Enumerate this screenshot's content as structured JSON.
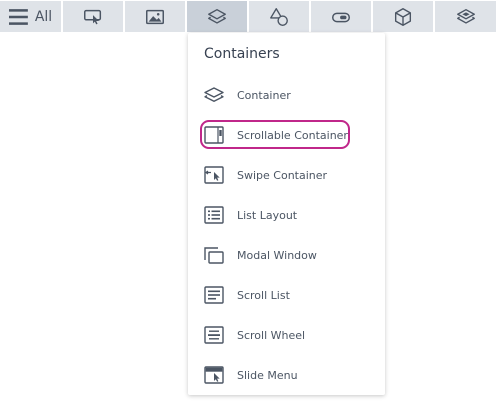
{
  "toolbar": {
    "all_label": "All",
    "tabs": [
      {
        "icon": "tap-gesture-icon"
      },
      {
        "icon": "image-icon"
      },
      {
        "icon": "layers-icon",
        "active": true
      },
      {
        "icon": "shapes-icon"
      },
      {
        "icon": "toggle-icon"
      },
      {
        "icon": "cube-icon"
      },
      {
        "icon": "layers-stack-icon"
      }
    ]
  },
  "dropdown": {
    "title": "Containers",
    "items": [
      {
        "label": "Container",
        "icon": "layers-icon"
      },
      {
        "label": "Scrollable Container",
        "icon": "scrollable-container-icon",
        "highlighted": true
      },
      {
        "label": "Swipe Container",
        "icon": "swipe-container-icon"
      },
      {
        "label": "List Layout",
        "icon": "list-layout-icon"
      },
      {
        "label": "Modal Window",
        "icon": "modal-window-icon"
      },
      {
        "label": "Scroll List",
        "icon": "scroll-list-icon"
      },
      {
        "label": "Scroll Wheel",
        "icon": "scroll-wheel-icon"
      },
      {
        "label": "Slide Menu",
        "icon": "slide-menu-icon"
      }
    ]
  },
  "colors": {
    "tab_bg": "#dfe3e8",
    "tab_active_bg": "#c9d0d9",
    "highlight": "#c0278a",
    "icon": "#4b5563"
  }
}
